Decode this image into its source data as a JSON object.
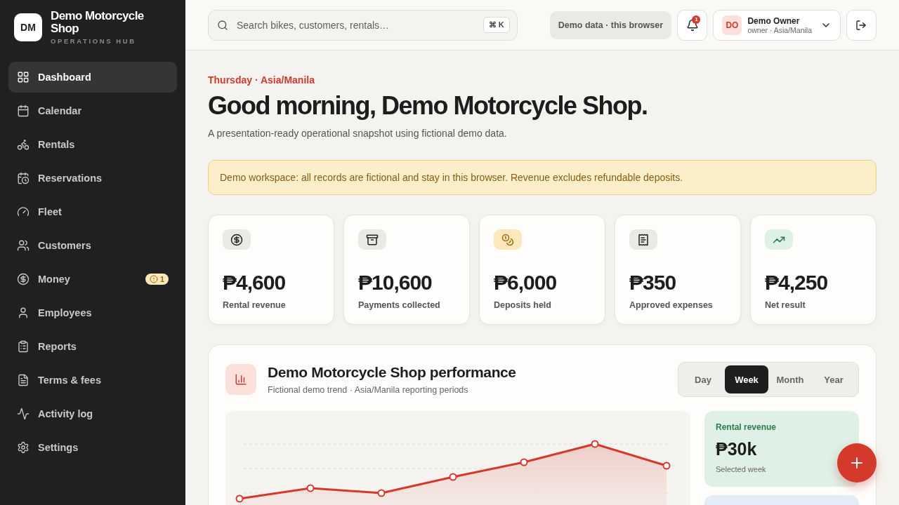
{
  "brand": {
    "initials": "DM",
    "name": "Demo Motorcycle Shop",
    "subtitle": "OPERATIONS HUB"
  },
  "nav": [
    {
      "label": "Dashboard",
      "selected": true
    },
    {
      "label": "Calendar",
      "selected": false
    },
    {
      "label": "Rentals",
      "selected": false
    },
    {
      "label": "Reservations",
      "selected": false
    },
    {
      "label": "Fleet",
      "selected": false
    },
    {
      "label": "Customers",
      "selected": false
    },
    {
      "label": "Money",
      "selected": false,
      "badge": "1"
    },
    {
      "label": "Employees",
      "selected": false
    },
    {
      "label": "Reports",
      "selected": false
    },
    {
      "label": "Terms & fees",
      "selected": false
    },
    {
      "label": "Activity log",
      "selected": false
    },
    {
      "label": "Settings",
      "selected": false
    }
  ],
  "topbar": {
    "search": {
      "placeholder": "Search bikes, customers, rentals…",
      "shortcut": "⌘ K"
    },
    "demo_chip": "Demo data · this browser",
    "notifications": "1",
    "user": {
      "initials": "DO",
      "name": "Demo Owner",
      "role": "owner · Asia/Manila"
    }
  },
  "greeting": {
    "eyebrow": "Thursday · Asia/Manila",
    "title": "Good morning, Demo Motorcycle Shop.",
    "subtitle": "A presentation-ready operational snapshot using fictional demo data."
  },
  "notice": "Demo workspace: all records are fictional and stay in this browser. Revenue excludes refundable deposits.",
  "stats": [
    {
      "value": "₱4,600",
      "label": "Rental revenue"
    },
    {
      "value": "₱10,600",
      "label": "Payments collected"
    },
    {
      "value": "₱6,000",
      "label": "Deposits held"
    },
    {
      "value": "₱350",
      "label": "Approved expenses"
    },
    {
      "value": "₱4,250",
      "label": "Net result"
    }
  ],
  "performance": {
    "title": "Demo Motorcycle Shop performance",
    "subtitle": "Fictional demo trend · Asia/Manila reporting periods",
    "periods": [
      {
        "label": "Day",
        "selected": false
      },
      {
        "label": "Week",
        "selected": true
      },
      {
        "label": "Month",
        "selected": false
      },
      {
        "label": "Year",
        "selected": false
      }
    ],
    "summary": {
      "label": "Rental revenue",
      "value": "₱30k",
      "caption": "Selected week"
    }
  }
}
